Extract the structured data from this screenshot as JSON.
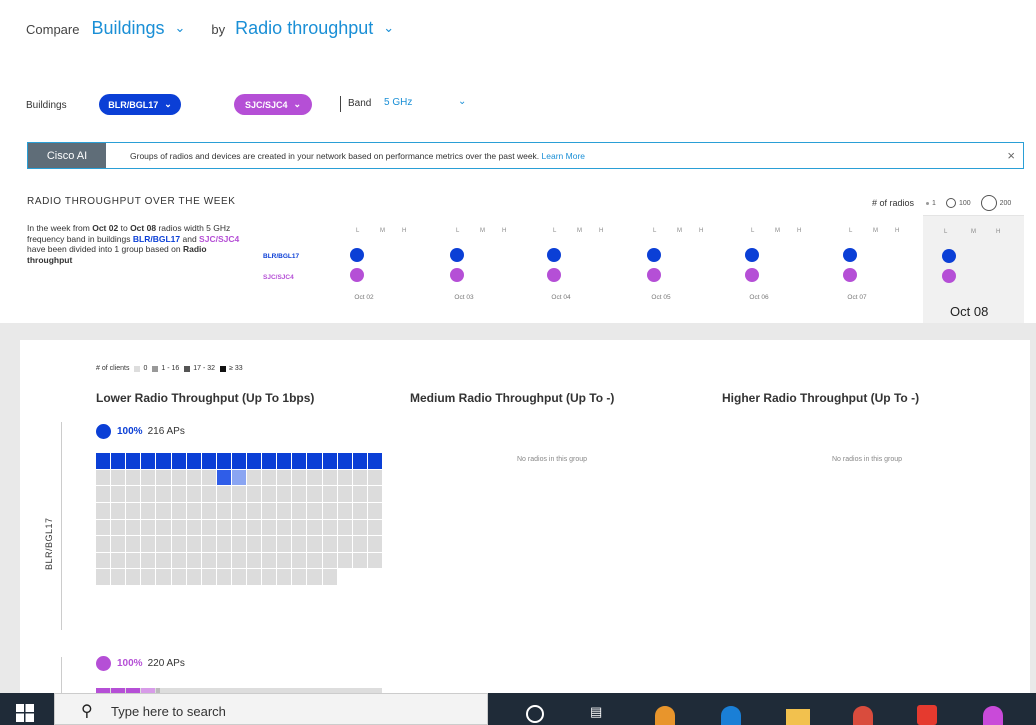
{
  "compare": {
    "label": "Compare",
    "entity": "Buildings",
    "by_label": "by",
    "metric": "Radio throughput"
  },
  "filters": {
    "buildings_label": "Buildings",
    "building_a": "BLR/BGL17",
    "building_b": "SJC/SJC4",
    "band_label": "Band",
    "band_value": "5 GHz"
  },
  "banner": {
    "tag": "Cisco AI",
    "message": "Groups of radios and devices are created in your network based on performance metrics over the past week.",
    "link": "Learn More",
    "close": "×"
  },
  "section": {
    "title": "RADIO THROUGHPUT OVER THE WEEK",
    "radios_label": "# of radios",
    "legend_values": [
      "1",
      "100",
      "200"
    ]
  },
  "summary": {
    "t1": "In the week from",
    "d1": "Oct 02",
    "t2": "to",
    "d2": "Oct 08",
    "t3": "radios width 5 GHz frequency band in buildings",
    "b1": "BLR/BGL17",
    "t4": "and",
    "b2": "SJC/SJC4",
    "t5": "have been divided into 1 group based on",
    "metric": "Radio throughput"
  },
  "row_labels": {
    "a": "BLR/BGL17",
    "b": "SJC/SJC4"
  },
  "lmh": [
    "L",
    "M",
    "H"
  ],
  "days": [
    "Oct 02",
    "Oct 03",
    "Oct 04",
    "Oct 05",
    "Oct 06",
    "Oct 07"
  ],
  "selected_day": "Oct 08",
  "clients_legend": {
    "label": "# of clients",
    "items": [
      "0",
      "1 - 16",
      "17 - 32",
      "≥ 33"
    ]
  },
  "columns": {
    "lower": "Lower Radio Throughput (Up To 1bps)",
    "medium": "Medium Radio Throughput (Up To -)",
    "higher": "Higher Radio Throughput (Up To -)"
  },
  "group_a": {
    "building": "BLR/BGL17",
    "pct": "100%",
    "aps": "216 APs"
  },
  "group_b": {
    "pct": "100%",
    "aps": "220 APs"
  },
  "no_radios": "No radios in this group",
  "taskbar": {
    "search_placeholder": "Type here to search"
  },
  "colors": {
    "blue": "#0b3fd6",
    "purple": "#b54fd6",
    "accent": "#1a8fd6"
  }
}
